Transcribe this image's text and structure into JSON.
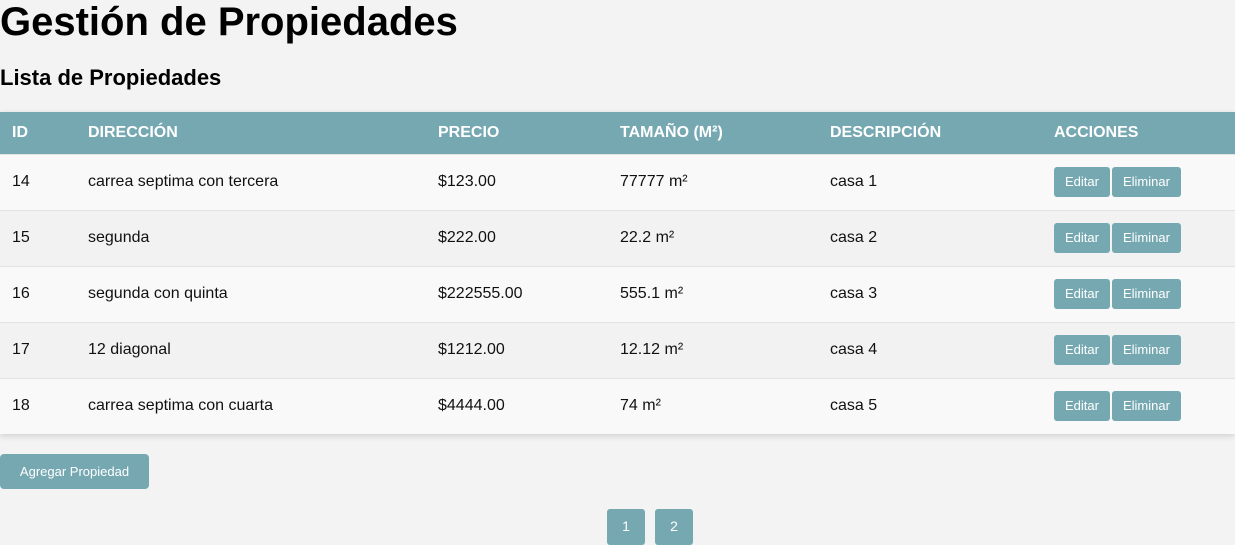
{
  "header": {
    "title": "Gestión de Propiedades",
    "subtitle": "Lista de Propiedades"
  },
  "table": {
    "columns": [
      "ID",
      "DIRECCIÓN",
      "PRECIO",
      "TAMAÑO (M²)",
      "DESCRIPCIÓN",
      "ACCIONES"
    ],
    "rows": [
      {
        "id": "14",
        "direccion": "carrea septima con tercera",
        "precio": "$123.00",
        "tamano": "77777 m²",
        "descripcion": "casa 1"
      },
      {
        "id": "15",
        "direccion": "segunda",
        "precio": "$222.00",
        "tamano": "22.2 m²",
        "descripcion": "casa 2"
      },
      {
        "id": "16",
        "direccion": "segunda con quinta",
        "precio": "$222555.00",
        "tamano": "555.1 m²",
        "descripcion": "casa 3"
      },
      {
        "id": "17",
        "direccion": "12 diagonal",
        "precio": "$1212.00",
        "tamano": "12.12 m²",
        "descripcion": "casa 4"
      },
      {
        "id": "18",
        "direccion": "carrea septima con cuarta",
        "precio": "$4444.00",
        "tamano": "74 m²",
        "descripcion": "casa 5"
      }
    ],
    "edit_label": "Editar",
    "delete_label": "Eliminar"
  },
  "actions": {
    "add_label": "Agregar Propiedad"
  },
  "pagination": {
    "pages": [
      "1",
      "2"
    ]
  },
  "colors": {
    "accent": "#76a8b2",
    "background": "#f3f3f3"
  }
}
